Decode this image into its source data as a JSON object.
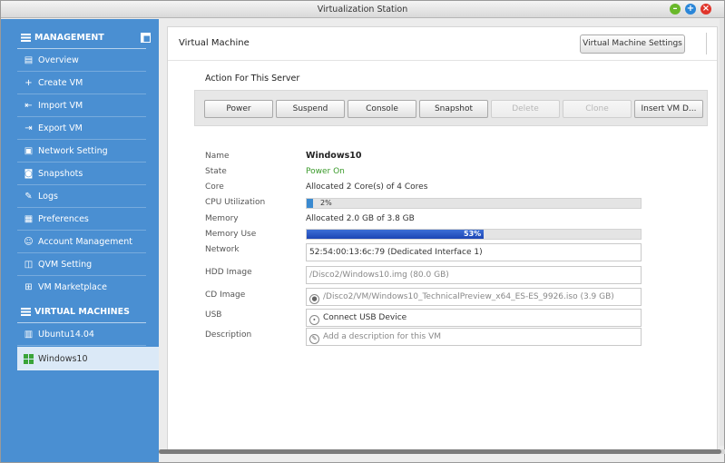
{
  "window": {
    "title": "Virtualization Station"
  },
  "sidebar": {
    "management_heading": "MANAGEMENT",
    "management_items": [
      {
        "label": "Overview",
        "icon": "document-icon"
      },
      {
        "label": "Create VM",
        "icon": "plus-icon"
      },
      {
        "label": "Import VM",
        "icon": "import-icon"
      },
      {
        "label": "Export VM",
        "icon": "export-icon"
      },
      {
        "label": "Network Setting",
        "icon": "network-icon"
      },
      {
        "label": "Snapshots",
        "icon": "camera-icon"
      },
      {
        "label": "Logs",
        "icon": "logs-icon"
      },
      {
        "label": "Preferences",
        "icon": "preferences-icon"
      },
      {
        "label": "Account Management",
        "icon": "account-icon"
      },
      {
        "label": "QVM Setting",
        "icon": "qvm-icon"
      },
      {
        "label": "VM Marketplace",
        "icon": "marketplace-icon"
      }
    ],
    "vm_heading": "VIRTUAL MACHINES",
    "vm_items": [
      {
        "label": "Ubuntu14.04",
        "icon": "ubuntu-icon"
      },
      {
        "label": "Windows10",
        "icon": "windows-icon",
        "selected": true
      }
    ]
  },
  "main": {
    "title": "Virtual Machine",
    "settings_button": "Virtual Machine Settings",
    "action_title": "Action For This Server",
    "actions": [
      {
        "label": "Power",
        "enabled": true
      },
      {
        "label": "Suspend",
        "enabled": true
      },
      {
        "label": "Console",
        "enabled": true
      },
      {
        "label": "Snapshot",
        "enabled": true
      },
      {
        "label": "Delete",
        "enabled": false
      },
      {
        "label": "Clone",
        "enabled": false
      },
      {
        "label": "Insert VM D...",
        "enabled": true
      }
    ],
    "details": {
      "name_label": "Name",
      "name_value": "Windows10",
      "state_label": "State",
      "state_value": "Power On",
      "core_label": "Core",
      "core_value": "Allocated 2 Core(s) of 4 Cores",
      "cpu_label": "CPU Utilization",
      "cpu_text": "2%",
      "cpu_percent": 2,
      "memory_label": "Memory",
      "memory_value": "Allocated 2.0 GB of 3.8 GB",
      "memuse_label": "Memory Use",
      "memuse_text": "53%",
      "memuse_percent": 53,
      "network_label": "Network",
      "network_value": "52:54:00:13:6c:79 (Dedicated Interface 1)",
      "hdd_label": "HDD Image",
      "hdd_value": "/Disco2/Windows10.img (80.0 GB)",
      "cd_label": "CD Image",
      "cd_value": "/Disco2/VM/Windows10_TechnicalPreview_x64_ES-ES_9926.iso (3.9 GB)",
      "usb_label": "USB",
      "usb_value": "Connect USB Device",
      "desc_label": "Description",
      "desc_placeholder": "Add a description for this VM"
    }
  },
  "colors": {
    "sidebar": "#4a8fd2",
    "state_on": "#3a9a2a",
    "memory_bar": "#1c45b4",
    "cpu_bar": "#3a8ad0"
  }
}
